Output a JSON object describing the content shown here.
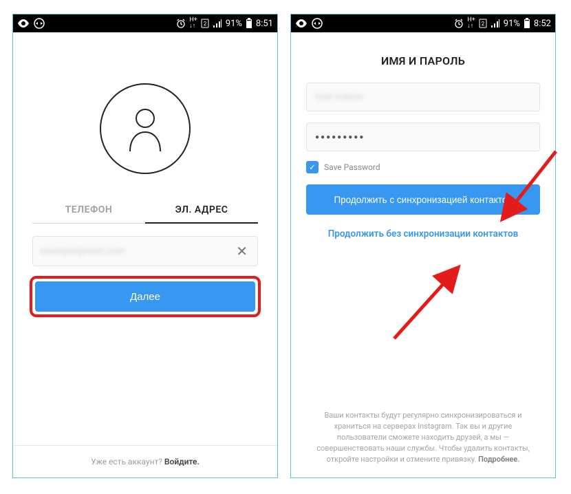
{
  "statusbar": {
    "battery": "91%",
    "time1": "8:51",
    "time2": "8:52"
  },
  "screen1": {
    "tabs": {
      "phone": "ТЕЛЕФОН",
      "email": "ЭЛ. АДРЕС"
    },
    "email_value": "example@mail.com",
    "next_button": "Далее",
    "footer_prefix": "Уже есть аккаунт? ",
    "footer_link": "Войдите."
  },
  "screen2": {
    "title": "ИМЯ И ПАРОЛЬ",
    "name_value": "Ivan Ivanov",
    "password_mask": "●●●●●●●●●",
    "save_password": "Save Password",
    "continue_sync": "Продолжить с синхронизацией контактов",
    "continue_no_sync": "Продолжить без синхронизации контактов",
    "disclaimer": "Ваши контакты будут регулярно синхронизироваться и храниться на серверах Instagram. Так вы и другие пользователи сможете находить друзей, а мы — совершенствовать наши службы. Чтобы удалить контакты, откройте настройки и отмените привязку. ",
    "more": "Подробнее."
  }
}
